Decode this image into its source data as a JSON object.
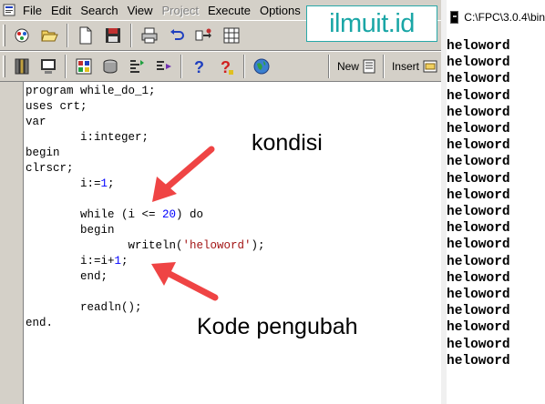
{
  "ide": {
    "menu": [
      {
        "id": "file",
        "label": "File",
        "disabled": false
      },
      {
        "id": "edit",
        "label": "Edit",
        "disabled": false
      },
      {
        "id": "search",
        "label": "Search",
        "disabled": false
      },
      {
        "id": "view",
        "label": "View",
        "disabled": false
      },
      {
        "id": "project",
        "label": "Project",
        "disabled": true
      },
      {
        "id": "execute",
        "label": "Execute",
        "disabled": false
      },
      {
        "id": "options",
        "label": "Options",
        "disabled": false
      }
    ],
    "toolbar1_icons": [
      "project-icon",
      "open-folder-icon",
      "new-file-icon",
      "save-icon",
      "print-icon",
      "undo-icon",
      "replace-icon",
      "grid-icon"
    ],
    "toolbar2_icons": [
      "compile-icon",
      "monitor-icon",
      "run-icon",
      "rebuild-icon",
      "debug-step-icon",
      "debug-icon",
      "help-icon",
      "help-context-icon",
      "globe-icon"
    ],
    "toolbar2_text_buttons": {
      "new": "New",
      "insert": "Insert"
    },
    "code_lines": [
      "program while_do_1;",
      "uses crt;",
      "var",
      "        i:integer;",
      "begin",
      "clrscr;",
      "        i:=1;",
      "",
      "        while (i <= 20) do",
      "        begin",
      "               writeln('heloword');",
      "        i:=i+1;",
      "        end;",
      "",
      "        readln();",
      "end."
    ],
    "annotations": {
      "kondisi": "kondisi",
      "kode_pengubah": "Kode pengubah"
    },
    "arrow_color": "#ef4444"
  },
  "watermark": {
    "text": "ilmuit.id",
    "color": "#1aa6a6"
  },
  "console": {
    "title": "C:\\FPC\\3.0.4\\bin",
    "output_lines": [
      "heloword",
      "heloword",
      "heloword",
      "heloword",
      "heloword",
      "heloword",
      "heloword",
      "heloword",
      "heloword",
      "heloword",
      "heloword",
      "heloword",
      "heloword",
      "heloword",
      "heloword",
      "heloword",
      "heloword",
      "heloword",
      "heloword",
      "heloword"
    ]
  }
}
